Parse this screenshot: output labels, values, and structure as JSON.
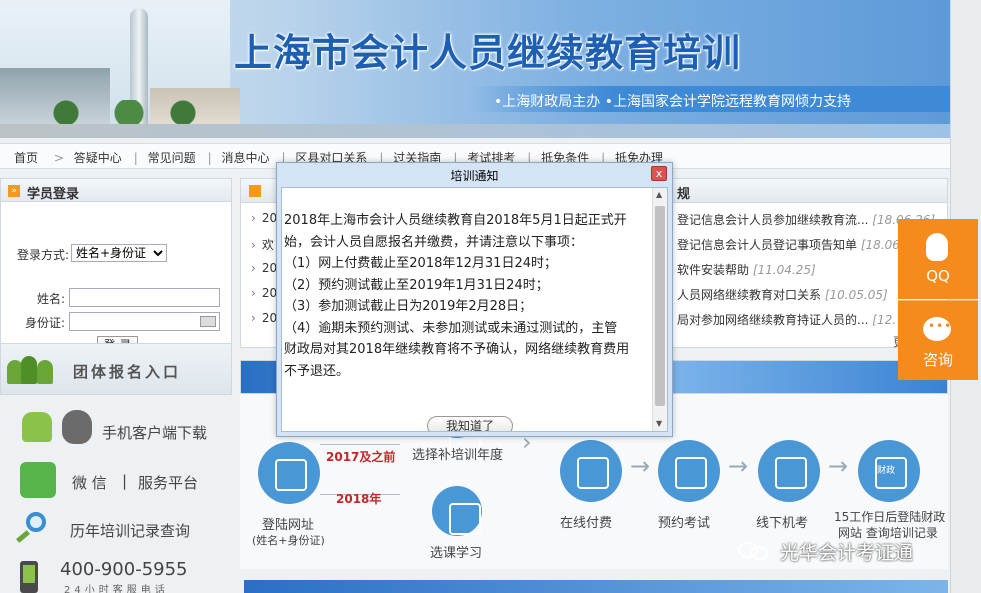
{
  "banner": {
    "title": "上海市会计人员继续教育培训",
    "subtitle": "•上海财政局主办   •上海国家会计学院远程教育网倾力支持"
  },
  "nav": {
    "items": [
      "首页",
      ">",
      "答疑中心",
      "常见问题",
      "消息中心",
      "区县对口关系",
      "过关指南",
      "考试排考",
      "抵免条件",
      "抵免办理"
    ]
  },
  "login": {
    "header": "学员登录",
    "method_label": "登录方式:",
    "method_value": "姓名+身份证",
    "name_label": "姓名:",
    "id_label": "身份证:",
    "submit": "登 录"
  },
  "left_links": {
    "group": "团体报名入口",
    "app": "手机客户端下载",
    "wechat_a": "微 信",
    "wechat_sep": "|",
    "wechat_b": "服务平台",
    "records": "历年培训记录查询",
    "phone": "400-900-5955",
    "phone_sub": "24小时客服电话"
  },
  "news": {
    "right_header": "规",
    "left_items": [
      "20",
      "欢",
      "20",
      "20",
      "20"
    ],
    "right_items": [
      {
        "text": "登记信息会计人员参加继续教育流...",
        "date": "[18.06.26]"
      },
      {
        "text": "登记信息会计人员登记事项告知单",
        "date": "[18.06"
      },
      {
        "text": "软件安装帮助",
        "date": "[11.04.25]"
      },
      {
        "text": "人员网络继续教育对口关系",
        "date": "[10.05.05]"
      },
      {
        "text": "局对参加网络继续教育持证人员的...",
        "date": "[12."
      }
    ],
    "more": "更"
  },
  "flow": {
    "step1": "登陆网址",
    "step1_sub": "(姓名+身份证)",
    "year_a": "2017及之前",
    "year_b": "2018年",
    "step2": "选择补培训年度",
    "step3": "选课学习",
    "step4": "在线付费",
    "step5": "预约考试",
    "step6": "线下机考",
    "step7_a": "15工作日后登陆财政",
    "step7_b": "网站 查询培训记录",
    "finance_label": "财政"
  },
  "float": {
    "qq": "QQ",
    "consult": "咨询"
  },
  "watermark": "光华会计考证通",
  "modal": {
    "title": "培训通知",
    "close": "x",
    "lines": [
      "2018年上海市会计人员继续教育自2018年5月1日起正式开",
      "始，会计人员自愿报名并缴费，并请注意以下事项：",
      "（1）网上付费截止至2018年12月31日24时；",
      "（2）预约测试截止至2019年1月31日24时；",
      "（3）参加测试截止日为2019年2月28日；",
      "（4）逾期未预约测试、未参加测试或未通过测试的，主管",
      "财政局对其2018年继续教育将不予确认，网络继续教育费用",
      "不予退还。"
    ],
    "ok": "我知道了"
  }
}
